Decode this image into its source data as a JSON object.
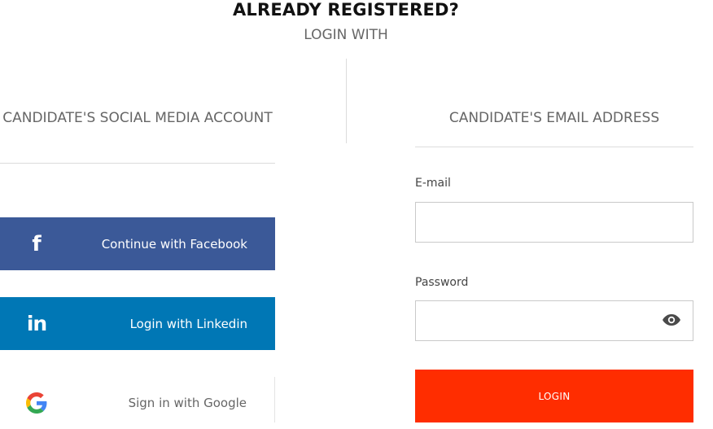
{
  "header": {
    "title": "ALREADY REGISTERED?",
    "subtitle": "LOGIN WITH"
  },
  "social": {
    "heading": "CANDIDATE'S SOCIAL MEDIA ACCOUNT",
    "facebook": {
      "label": "Continue with Facebook",
      "icon": "facebook-icon",
      "color": "#3b5998"
    },
    "linkedin": {
      "label": "Login with Linkedin",
      "icon": "linkedin-icon",
      "color": "#0077b5"
    },
    "google": {
      "label": "Sign in with Google",
      "icon": "google-icon",
      "color": "#ffffff"
    }
  },
  "email_login": {
    "heading": "CANDIDATE'S EMAIL ADDRESS",
    "email_label": "E-mail",
    "email_value": "",
    "password_label": "Password",
    "password_value": "",
    "show_password_icon": "eye-icon",
    "login_label": "LOGIN",
    "login_color": "#ff2d00"
  }
}
